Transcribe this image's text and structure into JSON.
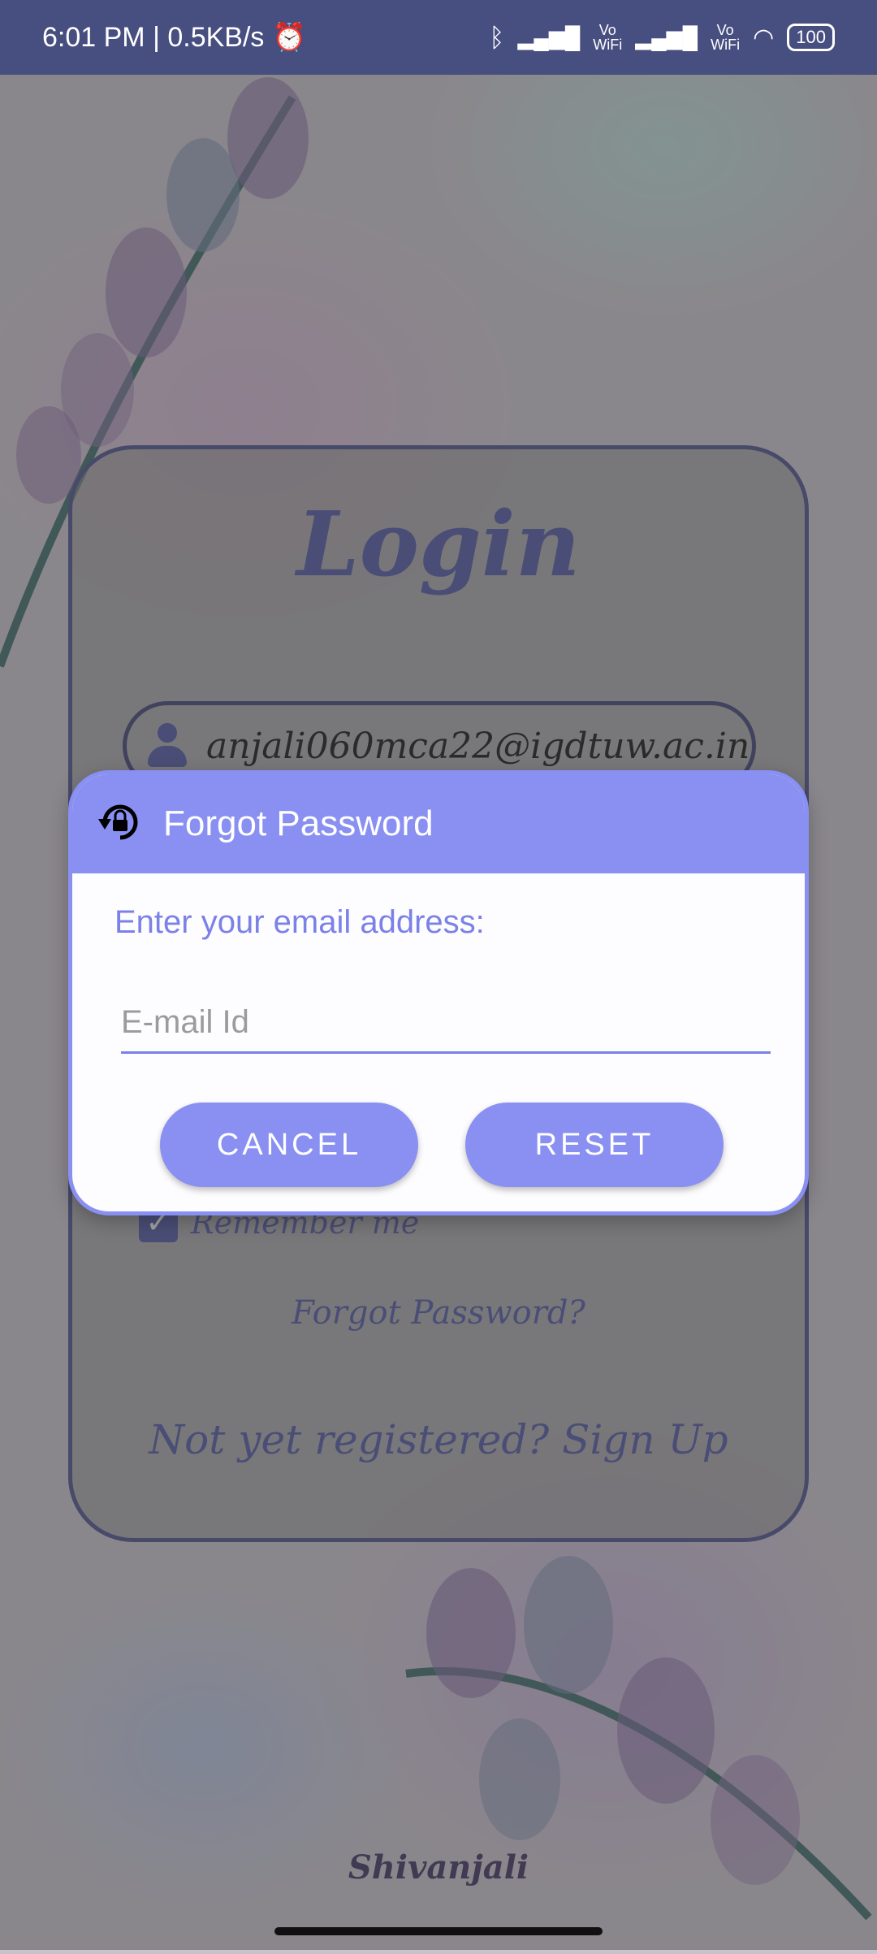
{
  "status_bar": {
    "time": "6:01 PM | 0.5KB/s",
    "wifi_label_1": "Vo\nWiFi",
    "wifi_label_2": "Vo\nWiFi",
    "battery": "100"
  },
  "login": {
    "title": "Login",
    "email_value": "anjali060mca22@igdtuw.ac.in",
    "remember_label": "Remember me",
    "forgot_link": "Forgot Password?",
    "signup_link": "Not yet registered? Sign Up"
  },
  "dialog": {
    "title": "Forgot Password",
    "prompt": "Enter your email address:",
    "email_placeholder": "E-mail Id",
    "cancel_label": "CANCEL",
    "reset_label": "RESET"
  },
  "footer": {
    "brand": "Shivanjali"
  },
  "colors": {
    "status_bar": "#474e80",
    "accent": "#8990f2",
    "login_text": "#4e56a6"
  }
}
